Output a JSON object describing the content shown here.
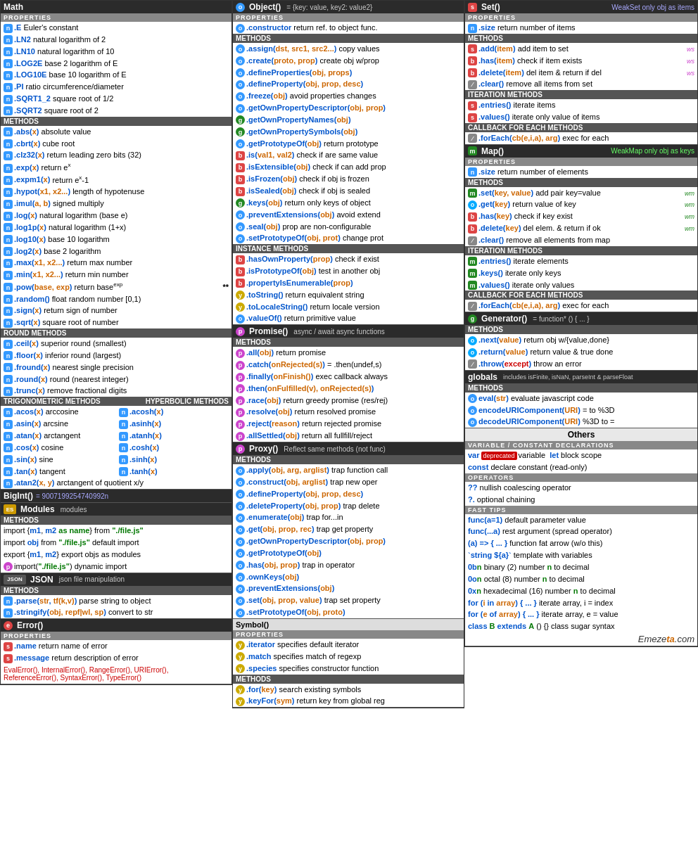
{
  "col1": {
    "math": {
      "title": "Math",
      "props_header": "PROPERTIES",
      "properties": [
        {
          "badge": "n",
          "text": ".E",
          "desc": "Euler's constant"
        },
        {
          "badge": "n",
          "text": ".LN2",
          "desc": "natural logarithm of 2"
        },
        {
          "badge": "n",
          "text": ".LN10",
          "desc": "natural logarithm of 10"
        },
        {
          "badge": "n",
          "text": ".LOG2E",
          "desc": "base 2 logarithm of E"
        },
        {
          "badge": "n",
          "text": ".LOG10E",
          "desc": "base 10 logarithm of E"
        },
        {
          "badge": "n",
          "text": ".PI",
          "desc": "ratio circumference/diameter"
        },
        {
          "badge": "n",
          "text": ".SQRT1_2",
          "desc": "square root of 1/2"
        },
        {
          "badge": "n",
          "text": ".SQRT2",
          "desc": "square root of 2"
        }
      ],
      "methods_header": "METHODS",
      "methods": [
        {
          "badge": "n",
          "text": ".abs(x)",
          "desc": "absolute value"
        },
        {
          "badge": "n",
          "text": ".cbrt(x)",
          "desc": "cube root"
        },
        {
          "badge": "n",
          "text": ".clz32(x)",
          "desc": "return leading zero bits (32)"
        },
        {
          "badge": "n",
          "text": ".exp(x)",
          "desc": "return eˣ"
        },
        {
          "badge": "n",
          "text": ".expm1(x)",
          "desc": "return eˣ-1"
        },
        {
          "badge": "n",
          "text": ".hypot(x1, x2...)",
          "desc": "length of hypotenuse"
        },
        {
          "badge": "n",
          "text": ".imul(a, b)",
          "desc": "signed multiply"
        },
        {
          "badge": "n",
          "text": ".log(x)",
          "desc": "natural logarithm (base e)"
        },
        {
          "badge": "n",
          "text": ".log1p(x)",
          "desc": "natural logarithm (1+x)"
        },
        {
          "badge": "n",
          "text": ".log10(x)",
          "desc": "base 10 logarithm"
        },
        {
          "badge": "n",
          "text": ".log2(x)",
          "desc": "base 2 logarithm"
        },
        {
          "badge": "n",
          "text": ".max(x1, x2...)",
          "desc": "return max number"
        },
        {
          "badge": "n",
          "text": ".min(x1, x2...)",
          "desc": "return min number"
        },
        {
          "badge": "n",
          "text": ".pow(base, exp)",
          "desc": "return base",
          "sup": "exp",
          "star": "**"
        },
        {
          "badge": "n",
          "text": ".random()",
          "desc": "float random number [0,1)"
        },
        {
          "badge": "n",
          "text": ".sign(x)",
          "desc": "return sign of number"
        },
        {
          "badge": "n",
          "text": ".sqrt(x)",
          "desc": "square root of number"
        }
      ],
      "round_header": "ROUND METHODS",
      "round_methods": [
        {
          "badge": "n",
          "text": ".ceil(x)",
          "desc": "superior round (smallest)"
        },
        {
          "badge": "n",
          "text": ".floor(x)",
          "desc": "inferior round (largest)"
        },
        {
          "badge": "n",
          "text": ".fround(x)",
          "desc": "nearest single precision"
        },
        {
          "badge": "n",
          "text": ".round(x)",
          "desc": "round (nearest integer)"
        },
        {
          "badge": "n",
          "text": ".trunc(x)",
          "desc": "remove fractional digits"
        }
      ],
      "trig_header": "TRIGONOMETRIC METHODS",
      "hyp_header": "HYPERBOLIC METHODS",
      "trig_methods": [
        {
          "badge": "n",
          "left": ".acos(x)",
          "left_desc": "arccosine",
          "badge2": "n",
          "right": ".acosh(x)",
          "right_desc": ""
        },
        {
          "badge": "n",
          "left": ".asin(x)",
          "left_desc": "arcsine",
          "badge2": "n",
          "right": ".asinh(x)",
          "right_desc": ""
        },
        {
          "badge": "n",
          "left": ".atan(x)",
          "left_desc": "arctangent",
          "badge2": "n",
          "right": ".atanh(x)",
          "right_desc": ""
        },
        {
          "badge": "n",
          "left": ".cos(x)",
          "left_desc": "cosine",
          "badge2": "n",
          "right": ".cosh(x)",
          "right_desc": ""
        },
        {
          "badge": "n",
          "left": ".sin(x)",
          "left_desc": "sine",
          "badge2": "n",
          "right": ".sinh(x)",
          "right_desc": ""
        },
        {
          "badge": "n",
          "left": ".tan(x)",
          "left_desc": "tangent",
          "badge2": "n",
          "right": ".tanh(x)",
          "right_desc": ""
        }
      ],
      "atan2": {
        "badge": "n",
        "text": ".atan2(x, y)",
        "desc": "arctangent of quotient x/y"
      }
    },
    "bigint": {
      "title": "BigInt()",
      "subtitle": "= 9007199254740992n"
    },
    "modules": {
      "badge": "ES",
      "title": "Modules",
      "subtitle": "modules",
      "methods_header": "METHODS",
      "items": [
        {
          "text": "import {m1, m2 as name} from \"./file.js\""
        },
        {
          "text": "import obj from \"./file.js\" default import"
        },
        {
          "text": "export {m1, m2} export objs as modules"
        },
        {
          "badge": "p",
          "text": "import(\"./file.js\") dynamic import"
        }
      ]
    },
    "json": {
      "badge": "JSON",
      "title": "JSON",
      "subtitle": "json file manipulation",
      "methods_header": "METHODS",
      "items": [
        {
          "badge": "n",
          "text": ".parse(str, tf(k,v))",
          "desc": "parse string to object"
        },
        {
          "badge": "n",
          "text": ".stringify(obj, repf|wl, sp)",
          "desc": "convert to str"
        }
      ]
    },
    "error": {
      "badge": "e",
      "title": "Error()",
      "props_header": "PROPERTIES",
      "properties": [
        {
          "badge": "s",
          "text": ".name",
          "desc": "return name of error"
        },
        {
          "badge": "s",
          "text": ".message",
          "desc": "return description of error"
        }
      ],
      "footer": "EvalError(), InternalError(), RangeError(), URIError(),\nReferenceError(), SyntaxError(), TypeError()"
    }
  },
  "col2": {
    "object": {
      "title": "Object()",
      "subtitle": "= {key: value, key2: value2}",
      "props_header": "PROPERTIES",
      "properties": [
        {
          "badge": "o",
          "text": ".constructor",
          "desc": "return ref. to object func."
        }
      ],
      "methods_header": "METHODS",
      "methods": [
        {
          "badge": "o",
          "text": ".assign(dst, src1, src2...)",
          "desc": "copy values"
        },
        {
          "badge": "o",
          "text": ".create(proto, prop)",
          "desc": "create obj w/prop"
        },
        {
          "badge": "o",
          "text": ".defineProperties(obj, props)"
        },
        {
          "badge": "o",
          "text": ".defineProperty(obj, prop, desc)"
        },
        {
          "badge": "o",
          "text": ".freeze(obj)",
          "desc": "avoid properties changes"
        },
        {
          "badge": "o",
          "text": ".getOwnPropertyDescriptor(obj, prop)"
        },
        {
          "badge": "g",
          "text": ".getOwnPropertyNames(obj)"
        },
        {
          "badge": "g",
          "text": ".getOwnPropertySymbols(obj)"
        },
        {
          "badge": "o",
          "text": ".getPrototypeOf(obj)",
          "desc": "return prototype"
        },
        {
          "badge": "b",
          "text": ".is(val1, val2)",
          "desc": "check if are same value"
        },
        {
          "badge": "b",
          "text": ".isExtensible(obj)",
          "desc": "check if can add prop"
        },
        {
          "badge": "b",
          "text": ".isFrozen(obj)",
          "desc": "check if obj is frozen"
        },
        {
          "badge": "b",
          "text": ".isSealed(obj)",
          "desc": "check if obj is sealed"
        },
        {
          "badge": "g",
          "text": ".keys(obj)",
          "desc": "return only keys of object"
        },
        {
          "badge": "o",
          "text": ".preventExtensions(obj)",
          "desc": "avoid extend"
        },
        {
          "badge": "o",
          "text": ".seal(obj)",
          "desc": "prop are non-configurable"
        },
        {
          "badge": "o",
          "text": ".setPrototypeOf(obj, prot)",
          "desc": "change prot"
        }
      ],
      "instance_header": "INSTANCE METHODS",
      "instance_methods": [
        {
          "badge": "b",
          "text": ".hasOwnProperty(prop)",
          "desc": "check if exist"
        },
        {
          "badge": "b",
          "text": ".isPrototypeOf(obj)",
          "desc": "test in another obj"
        },
        {
          "badge": "b",
          "text": ".propertyIsEnumerable(prop)"
        },
        {
          "badge": "y",
          "text": ".toString()",
          "desc": "return equivalent string"
        },
        {
          "badge": "y",
          "text": ".toLocaleString()",
          "desc": "return locale version"
        },
        {
          "badge": "o",
          "text": ".valueOf()",
          "desc": "return primitive value"
        }
      ]
    },
    "promise": {
      "badge": "p",
      "title": "Promise()",
      "subtitle": "async / await async functions",
      "methods_header": "METHODS",
      "methods": [
        {
          "badge": "p",
          "text": ".all(obj)",
          "desc": "return promise"
        },
        {
          "badge": "p",
          "text": ".catch(onRejected(s))",
          "desc": "= .then(undef,s)"
        },
        {
          "badge": "p",
          "text": ".finally(onFinish())",
          "desc": "exec callback always"
        },
        {
          "badge": "p",
          "text": ".then(onFulfilled(v), onRejected(s))"
        },
        {
          "badge": "p",
          "text": ".race(obj)",
          "desc": "return greedy promise (res/rej)"
        },
        {
          "badge": "p",
          "text": ".resolve(obj)",
          "desc": "return resolved promise"
        },
        {
          "badge": "p",
          "text": ".reject(reason)",
          "desc": "return rejected promise"
        },
        {
          "badge": "p",
          "text": ".allSettled(obj)",
          "desc": "return all fullfill/reject"
        }
      ]
    },
    "proxy": {
      "badge": "p",
      "title": "Proxy()",
      "subtitle": "Reflect same methods (not func)",
      "methods_header": "METHODS",
      "methods": [
        {
          "badge": "o",
          "text": ".apply(obj, arg, arglist)",
          "desc": "trap function call"
        },
        {
          "badge": "o",
          "text": ".construct(obj, arglist)",
          "desc": "trap new oper"
        },
        {
          "badge": "o",
          "text": ".defineProperty(obj, prop, desc)"
        },
        {
          "badge": "o",
          "text": ".deleteProperty(obj, prop)",
          "desc": "trap delete"
        },
        {
          "badge": "o",
          "text": ".enumerate(obj)",
          "desc": "trap for...in"
        },
        {
          "badge": "o",
          "text": ".get(obj, prop, rec)",
          "desc": "trap get property"
        },
        {
          "badge": "o",
          "text": ".getOwnPropertyDescriptor(obj, prop)"
        },
        {
          "badge": "o",
          "text": ".getPrototypeOf(obj)"
        },
        {
          "badge": "o",
          "text": ".has(obj, prop)",
          "desc": "trap in operator"
        },
        {
          "badge": "o",
          "text": ".ownKeys(obj)"
        },
        {
          "badge": "o",
          "text": ".preventExtensions(obj)"
        },
        {
          "badge": "o",
          "text": ".set(obj, prop, value)",
          "desc": "trap set property"
        },
        {
          "badge": "o",
          "text": ".setPrototypeOf(obj, proto)"
        }
      ]
    },
    "symbol": {
      "badge": "s_sym",
      "title": "Symbol()",
      "props_header": "PROPERTIES",
      "properties": [
        {
          "badge": "y",
          "text": ".iterator",
          "desc": "specifies default iterator"
        },
        {
          "badge": "y",
          "text": ".match",
          "desc": "specifies match of regexp"
        },
        {
          "badge": "y",
          "text": ".species",
          "desc": "specifies constructor function"
        }
      ],
      "methods_header": "METHODS",
      "methods": [
        {
          "badge": "y",
          "text": ".for(key)",
          "desc": "search existing symbols"
        },
        {
          "badge": "y",
          "text": ".keyFor(sym)",
          "desc": "return key from global reg"
        }
      ]
    }
  },
  "col3": {
    "set": {
      "badge": "s",
      "title": "Set()",
      "subtitle": "WeakSet only obj as items",
      "props_header": "PROPERTIES",
      "properties": [
        {
          "badge": "n",
          "text": ".size",
          "desc": "return number of items"
        }
      ],
      "methods_header": "METHODS",
      "methods": [
        {
          "badge": "s",
          "text": ".add(item)",
          "desc": "add item to set",
          "ws": true
        },
        {
          "badge": "b",
          "text": ".has(item)",
          "desc": "check if item exists",
          "ws": true
        },
        {
          "badge": "b",
          "text": ".delete(item)",
          "desc": "del item & return if del",
          "ws": true
        },
        {
          "badge": "slash",
          "text": ".clear()",
          "desc": "remove all items from set"
        }
      ],
      "iteration_header": "ITERATION METHODS",
      "iteration_methods": [
        {
          "badge": "s",
          "text": ".entries()",
          "desc": "iterate items"
        },
        {
          "badge": "s",
          "text": ".values()",
          "desc": "iterate only value of items"
        }
      ],
      "callback_header": "CALLBACK FOR EACH METHODS",
      "callback_methods": [
        {
          "badge": "slash",
          "text": ".forEach(cb(e,i,a), arg)",
          "desc": "exec for each"
        }
      ]
    },
    "map": {
      "badge": "m",
      "title": "Map()",
      "subtitle": "WeakMap only obj as keys",
      "props_header": "PROPERTIES",
      "properties": [
        {
          "badge": "n",
          "text": ".size",
          "desc": "return number of elements"
        }
      ],
      "methods_header": "METHODS",
      "methods": [
        {
          "badge": "m",
          "text": ".set(key, value)",
          "desc": "add pair key=value",
          "wm": true
        },
        {
          "badge": "o2",
          "text": ".get(key)",
          "desc": "return value of key",
          "wm": true
        },
        {
          "badge": "b",
          "text": ".has(key)",
          "desc": "check if key exist",
          "wm": true
        },
        {
          "badge": "b",
          "text": ".delete(key)",
          "desc": "del elem. & return if ok",
          "wm": true
        },
        {
          "badge": "slash",
          "text": ".clear()",
          "desc": "remove all elements from map"
        }
      ],
      "iteration_header": "ITERATION METHODS",
      "iteration_methods": [
        {
          "badge": "m",
          "text": ".entries()",
          "desc": "iterate elements"
        },
        {
          "badge": "m",
          "text": ".keys()",
          "desc": "iterate only keys"
        },
        {
          "badge": "m",
          "text": ".values()",
          "desc": "iterate only values"
        }
      ],
      "callback_header": "CALLBACK FOR EACH METHODS",
      "callback_methods": [
        {
          "badge": "slash",
          "text": ".forEach(cb(e,i,a), arg)",
          "desc": "exec for each"
        }
      ]
    },
    "generator": {
      "badge": "g",
      "title": "Generator()",
      "subtitle": "= function* () { ... }",
      "methods_header": "METHODS",
      "methods": [
        {
          "badge": "o2",
          "text": ".next(value)",
          "desc": "return obj w/{value,done}"
        },
        {
          "badge": "o2",
          "text": ".return(value)",
          "desc": "return value & true done"
        },
        {
          "badge": "slash",
          "text": ".throw(except)",
          "desc": "throw an error"
        }
      ]
    },
    "globals": {
      "title": "globals",
      "subtitle": "includes isFinite, isNaN, parseInt & parseFloat",
      "methods_header": "METHODS",
      "methods": [
        {
          "badge": "o",
          "text": "eval(str)",
          "desc": "evaluate javascript code"
        },
        {
          "badge": "o",
          "text": "encodeURIComponent(URI)",
          "desc": "= to %3D"
        },
        {
          "badge": "o",
          "text": "decodeURIComponent(URI)",
          "desc": "%3D to ="
        }
      ]
    },
    "others": {
      "title": "Others",
      "var_header": "VARIABLE / CONSTANT DECLARATIONS",
      "var_items": [
        {
          "text": "var",
          "deprecated": true,
          "text2": "variable",
          "kw": "let",
          "text3": "block scope"
        },
        {
          "kw": "const",
          "text": "declare constant (read-only)"
        }
      ],
      "operators_header": "OPERATORS",
      "operators": [
        {
          "text": "??",
          "desc": "nullish coalescing operator"
        },
        {
          "text": "?.",
          "desc": "optional chaining"
        }
      ],
      "fasttips_header": "FAST TIPS",
      "fasttips": [
        {
          "kw": "func(a=1)",
          "desc": "default parameter value"
        },
        {
          "kw": "func(...a)",
          "desc": "rest argument (spread operator)"
        },
        {
          "text": "(a) => { ... }",
          "desc": "function fat arrow (w/o this)"
        },
        {
          "text": "`string ${a}`",
          "desc": "template with variables"
        },
        {
          "text": "0bn",
          "desc": "binary (2) number n to decimal"
        },
        {
          "text": "0on",
          "desc": "octal (8) number n to decimal"
        },
        {
          "text": "0xn",
          "desc": "hexadecimal (16) number n to decimal"
        },
        {
          "text": "for (i in array) { ... }",
          "desc": "iterate array, i = index"
        },
        {
          "text": "for (e of array) { ... }",
          "desc": "iterate array, e = value"
        },
        {
          "text": "class B extends A () {} class sugar syntax"
        }
      ]
    },
    "watermark": "Emezeta.com"
  }
}
